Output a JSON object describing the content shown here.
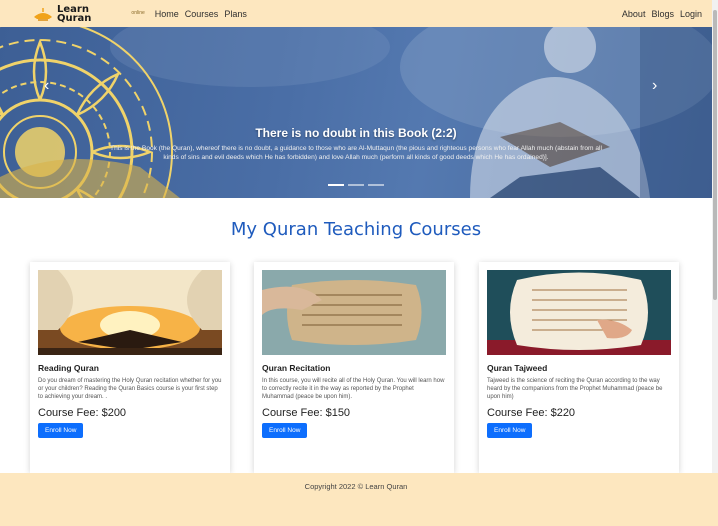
{
  "brand": {
    "line1": "Learn",
    "line2": "Quran",
    "sub": "online"
  },
  "nav": {
    "left": [
      "Home",
      "Courses",
      "Plans"
    ],
    "right": [
      "About",
      "Blogs",
      "Login"
    ]
  },
  "hero": {
    "title": "There is no doubt in this Book (2:2)",
    "text": "This is the Book (the Quran), whereof there is no doubt, a guidance to those who are Al-Muttaqun (the pious and righteous persons who fear Allah much (abstain from all kinds of sins and evil deeds which He has forbidden) and love Allah much (perform all kinds of good deeds which He has ordained)].",
    "prev_icon": "chevron-left-icon",
    "next_icon": "chevron-right-icon",
    "indicators": 3,
    "active_indicator": 0
  },
  "section": {
    "title": "My Quran Teaching Courses"
  },
  "courses": [
    {
      "title": "Reading Quran",
      "desc": "Do you dream of mastering the Holy Quran recitation whether for you or your children? Reading the Quran Basics course is your first step to achieving your dream. .",
      "fee": "Course Fee: $200",
      "button": "Enroll Now"
    },
    {
      "title": "Quran Recitation",
      "desc": "In this course, you will recite all of the Holy Quran. You will learn how to correctly recite it in the way as reported by the Prophet Muhammad (peace be upon him).",
      "fee": "Course Fee: $150",
      "button": "Enroll Now"
    },
    {
      "title": "Quran Tajweed",
      "desc": "Tajweed is the science of reciting the Quran according to the way heard by the companions from the Prophet Muhammad (peace be upon him)",
      "fee": "Course Fee: $220",
      "button": "Enroll Now"
    }
  ],
  "footer": {
    "text": "Copyright 2022 © Learn Quran"
  },
  "colors": {
    "navbar": "#fde7bf",
    "accent": "#1f5bbd",
    "button": "#0d6efd",
    "mandala": "#f0d36a"
  }
}
